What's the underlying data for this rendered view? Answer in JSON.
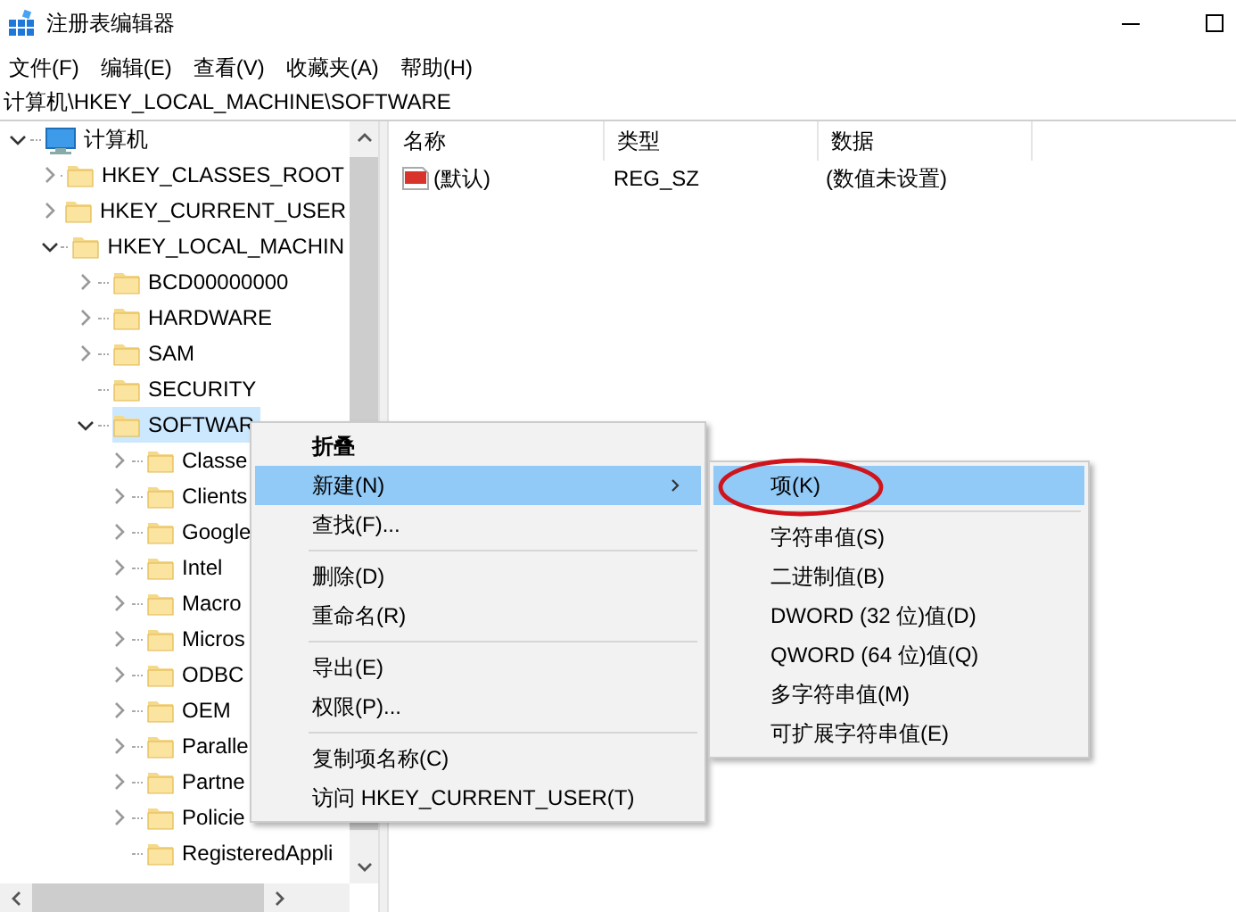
{
  "window": {
    "title": "注册表编辑器"
  },
  "menu_bar": [
    "文件(F)",
    "编辑(E)",
    "查看(V)",
    "收藏夹(A)",
    "帮助(H)"
  ],
  "address_bar": {
    "value": "计算机\\HKEY_LOCAL_MACHINE\\SOFTWARE"
  },
  "tree": [
    {
      "label": "计算机",
      "kind": "computer",
      "expanded": true,
      "selected": false,
      "children": [
        {
          "label": "HKEY_CLASSES_ROOT",
          "kind": "folder",
          "expanded": false,
          "selected": false
        },
        {
          "label": "HKEY_CURRENT_USER",
          "kind": "folder",
          "expanded": false,
          "selected": false
        },
        {
          "label": "HKEY_LOCAL_MACHIN",
          "kind": "folder",
          "expanded": true,
          "selected": false,
          "children": [
            {
              "label": "BCD00000000",
              "kind": "folder",
              "expanded": false,
              "selected": false
            },
            {
              "label": "HARDWARE",
              "kind": "folder",
              "expanded": false,
              "selected": false
            },
            {
              "label": "SAM",
              "kind": "folder",
              "expanded": false,
              "selected": false
            },
            {
              "label": "SECURITY",
              "kind": "leaf",
              "selected": false
            },
            {
              "label": "SOFTWAR",
              "kind": "folder",
              "expanded": true,
              "selected": true,
              "children": [
                {
                  "label": "Classe",
                  "kind": "folder",
                  "expanded": false,
                  "selected": false
                },
                {
                  "label": "Clients",
                  "kind": "folder",
                  "expanded": false,
                  "selected": false
                },
                {
                  "label": "Google",
                  "kind": "folder",
                  "expanded": false,
                  "selected": false
                },
                {
                  "label": "Intel",
                  "kind": "folder",
                  "expanded": false,
                  "selected": false
                },
                {
                  "label": "Macro",
                  "kind": "folder",
                  "expanded": false,
                  "selected": false
                },
                {
                  "label": "Micros",
                  "kind": "folder",
                  "expanded": false,
                  "selected": false
                },
                {
                  "label": "ODBC",
                  "kind": "folder",
                  "expanded": false,
                  "selected": false
                },
                {
                  "label": "OEM",
                  "kind": "folder",
                  "expanded": false,
                  "selected": false
                },
                {
                  "label": "Paralle",
                  "kind": "folder",
                  "expanded": false,
                  "selected": false
                },
                {
                  "label": "Partne",
                  "kind": "folder",
                  "expanded": false,
                  "selected": false
                },
                {
                  "label": "Policie",
                  "kind": "folder",
                  "expanded": false,
                  "selected": false
                },
                {
                  "label": "RegisteredAppli",
                  "kind": "leaf",
                  "selected": false
                }
              ]
            }
          ]
        }
      ]
    }
  ],
  "values_list": {
    "columns": [
      "名称",
      "类型",
      "数据"
    ],
    "rows": [
      {
        "name": "(默认)",
        "type": "REG_SZ",
        "data": "(数值未设置)"
      }
    ]
  },
  "context_menu": [
    {
      "kind": "item",
      "label": "折叠",
      "default": true,
      "selected": false,
      "has_submenu": false
    },
    {
      "kind": "item",
      "label": "新建(N)",
      "default": false,
      "selected": true,
      "has_submenu": true
    },
    {
      "kind": "item",
      "label": "查找(F)...",
      "default": false,
      "selected": false,
      "has_submenu": false
    },
    {
      "kind": "separator"
    },
    {
      "kind": "item",
      "label": "删除(D)",
      "default": false,
      "selected": false,
      "has_submenu": false
    },
    {
      "kind": "item",
      "label": "重命名(R)",
      "default": false,
      "selected": false,
      "has_submenu": false
    },
    {
      "kind": "separator"
    },
    {
      "kind": "item",
      "label": "导出(E)",
      "default": false,
      "selected": false,
      "has_submenu": false
    },
    {
      "kind": "item",
      "label": "权限(P)...",
      "default": false,
      "selected": false,
      "has_submenu": false
    },
    {
      "kind": "separator"
    },
    {
      "kind": "item",
      "label": "复制项名称(C)",
      "default": false,
      "selected": false,
      "has_submenu": false
    },
    {
      "kind": "item",
      "label": "访问 HKEY_CURRENT_USER(T)",
      "default": false,
      "selected": false,
      "has_submenu": false
    }
  ],
  "submenu": [
    {
      "kind": "item",
      "label": "项(K)",
      "selected": true,
      "circled": true
    },
    {
      "kind": "separator"
    },
    {
      "kind": "item",
      "label": "字符串值(S)",
      "selected": false,
      "circled": false
    },
    {
      "kind": "item",
      "label": "二进制值(B)",
      "selected": false,
      "circled": false
    },
    {
      "kind": "item",
      "label": "DWORD (32 位)值(D)",
      "selected": false,
      "circled": false
    },
    {
      "kind": "item",
      "label": "QWORD (64 位)值(Q)",
      "selected": false,
      "circled": false
    },
    {
      "kind": "item",
      "label": "多字符串值(M)",
      "selected": false,
      "circled": false
    },
    {
      "kind": "item",
      "label": "可扩展字符串值(E)",
      "selected": false,
      "circled": false
    }
  ]
}
